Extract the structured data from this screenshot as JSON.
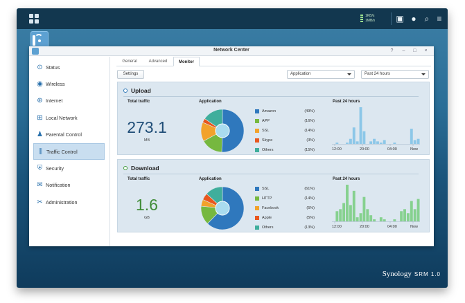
{
  "taskbar": {
    "speed_up": "1KB/s",
    "speed_down": "1MB/s",
    "icons": [
      "main-menu-icon",
      "chat-icon",
      "user-icon",
      "search-icon",
      "widgets-icon"
    ]
  },
  "window": {
    "title": "Network Center",
    "controls": {
      "help": "?",
      "minimize": "–",
      "maximize": "□",
      "close": "×"
    }
  },
  "sidebar": {
    "items": [
      {
        "label": "Status",
        "icon": "status-icon",
        "glyph": "⊙",
        "active": false
      },
      {
        "label": "Wireless",
        "icon": "wireless-icon",
        "glyph": "◉",
        "active": false
      },
      {
        "label": "Internet",
        "icon": "internet-icon",
        "glyph": "⊕",
        "active": false
      },
      {
        "label": "Local Network",
        "icon": "local-network-icon",
        "glyph": "⊞",
        "active": false
      },
      {
        "label": "Parental Control",
        "icon": "parental-control-icon",
        "glyph": "♟",
        "active": false
      },
      {
        "label": "Traffic Control",
        "icon": "traffic-control-icon",
        "glyph": "⫼",
        "active": true
      },
      {
        "label": "Security",
        "icon": "security-icon",
        "glyph": "⛨",
        "active": false
      },
      {
        "label": "Notification",
        "icon": "notification-icon",
        "glyph": "✉",
        "active": false
      },
      {
        "label": "Administration",
        "icon": "administration-icon",
        "glyph": "✂",
        "active": false
      }
    ]
  },
  "tabs": [
    "General",
    "Advanced",
    "Monitor"
  ],
  "active_tab": "Monitor",
  "toolbar": {
    "settings_label": "Settings",
    "filter_value": "Application",
    "range_value": "Past 24 hours"
  },
  "upload": {
    "title": "Upload",
    "total_label": "Total traffic",
    "total_value": "273.1",
    "total_unit": "MB",
    "app_label": "Application",
    "past_label": "Past 24 hours",
    "legend": [
      {
        "name": "Amazon",
        "pct": "(49%)",
        "value": 49,
        "color": "#2f78bd"
      },
      {
        "name": "APP",
        "pct": "(16%)",
        "value": 16,
        "color": "#76b83f"
      },
      {
        "name": "SSL",
        "pct": "(14%)",
        "value": 14,
        "color": "#f2a22b"
      },
      {
        "name": "Skype",
        "pct": "(3%)",
        "value": 3,
        "color": "#e8571e"
      },
      {
        "name": "Others",
        "pct": "(15%)",
        "value": 15,
        "color": "#3fae9c"
      }
    ],
    "bars": [
      0,
      1,
      0,
      0,
      1,
      4,
      13,
      2,
      29,
      10,
      0,
      2,
      4,
      2,
      1,
      3,
      0,
      0,
      1,
      0,
      0,
      0,
      0,
      12,
      3,
      4
    ],
    "ticks": [
      "12:00",
      "20:00",
      "04:00",
      "Now"
    ],
    "bar_color": "#8cc7e8"
  },
  "download": {
    "title": "Download",
    "total_label": "Total traffic",
    "total_value": "1.6",
    "total_unit": "GB",
    "app_label": "Application",
    "past_label": "Past 24 hours",
    "legend": [
      {
        "name": "SSL",
        "pct": "(61%)",
        "value": 61,
        "color": "#2f78bd"
      },
      {
        "name": "HTTP",
        "pct": "(14%)",
        "value": 14,
        "color": "#76b83f"
      },
      {
        "name": "Facebook",
        "pct": "(5%)",
        "value": 5,
        "color": "#f2a22b"
      },
      {
        "name": "Apple",
        "pct": "(5%)",
        "value": 5,
        "color": "#e8571e"
      },
      {
        "name": "Others",
        "pct": "(13%)",
        "value": 13,
        "color": "#3fae9c"
      }
    ],
    "bars": [
      0,
      5,
      6,
      9,
      18,
      8,
      15,
      2,
      4,
      12,
      6,
      3,
      1,
      0,
      2,
      1,
      0,
      0,
      1,
      0,
      5,
      6,
      4,
      10,
      6,
      11
    ],
    "ticks": [
      "12:00",
      "20:00",
      "04:00",
      "Now"
    ],
    "bar_color": "#86d18f"
  },
  "brand": {
    "name": "Synology",
    "product": "SRM 1.0"
  }
}
